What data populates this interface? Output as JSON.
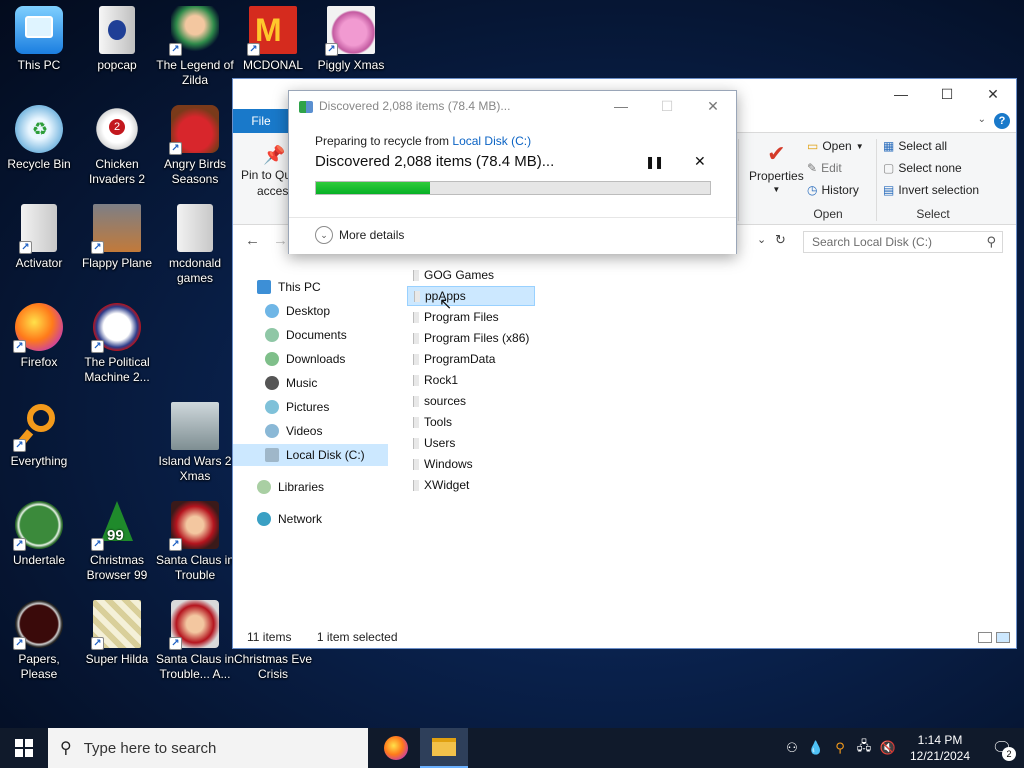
{
  "desktop": {
    "icons": [
      {
        "label": "This PC"
      },
      {
        "label": "popcap"
      },
      {
        "label": "The Legend of Zilda"
      },
      {
        "label": "MCDONAL TREASURE"
      },
      {
        "label": "Piggly Xmas"
      },
      {
        "label": "Recycle Bin"
      },
      {
        "label": "Chicken Invaders 2"
      },
      {
        "label": "Angry Birds Seasons"
      },
      {
        "label": "Activator"
      },
      {
        "label": "Flappy Plane"
      },
      {
        "label": "mcdonald games"
      },
      {
        "label": "Firefox"
      },
      {
        "label": "The Political Machine 2..."
      },
      {
        "label": "Everything"
      },
      {
        "label": "Island Wars 2 Xmas"
      },
      {
        "label": "Undertale"
      },
      {
        "label": "Christmas Browser 99"
      },
      {
        "label": "Santa Claus in Trouble"
      },
      {
        "label": "Papers, Please"
      },
      {
        "label": "Super Hilda"
      },
      {
        "label": "Santa Claus in Trouble... A..."
      },
      {
        "label": "Christmas Eve Crisis"
      }
    ]
  },
  "explorer": {
    "ribbon": {
      "file_tab": "File",
      "pin_label": "Pin to Quick access",
      "pin_short": "Pin to Qu",
      "pin_short2": "access",
      "properties": "Properties",
      "open": "Open",
      "edit": "Edit",
      "history": "History",
      "open_group": "Open",
      "select_all": "Select all",
      "select_none": "Select none",
      "invert_selection": "Invert selection",
      "select_group": "Select"
    },
    "search_placeholder": "Search Local Disk (C:)",
    "nav": {
      "this_pc": "This PC",
      "desktop": "Desktop",
      "documents": "Documents",
      "downloads": "Downloads",
      "music": "Music",
      "pictures": "Pictures",
      "videos": "Videos",
      "local_disk": "Local Disk (C:)",
      "libraries": "Libraries",
      "network": "Network"
    },
    "files": [
      "GOG Games",
      "ppApps",
      "Program Files",
      "Program Files (x86)",
      "ProgramData",
      "Rock1",
      "sources",
      "Tools",
      "Users",
      "Windows",
      "XWidget"
    ],
    "status": {
      "items": "11 items",
      "selected": "1 item selected"
    }
  },
  "dialog": {
    "title": "Discovered 2,088 items (78.4 MB)...",
    "prep_text": "Preparing to recycle from ",
    "prep_link": "Local Disk (C:)",
    "main_text": "Discovered 2,088 items (78.4 MB)...",
    "progress_percent": 29,
    "more_details": "More details"
  },
  "taskbar": {
    "search_placeholder": "Type here to search",
    "time": "1:14 PM",
    "date": "12/21/2024",
    "notification_count": "2"
  },
  "colors": {
    "accent": "#1979ca",
    "progress": "#06b025",
    "selection": "#cce8ff"
  }
}
